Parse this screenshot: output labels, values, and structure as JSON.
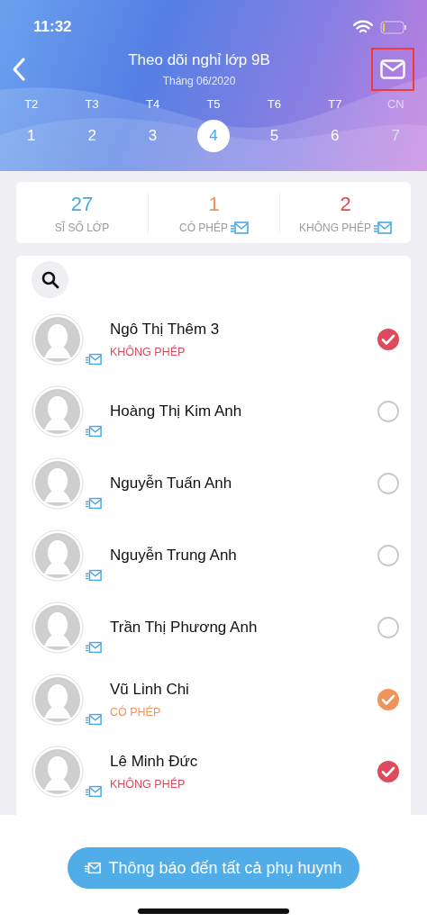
{
  "status_bar": {
    "time": "11:32"
  },
  "header": {
    "title": "Theo dõi nghỉ lớp 9B",
    "subtitle": "Tháng 06/2020",
    "mail_highlighted": true
  },
  "days": [
    {
      "label": "T2",
      "date": "1",
      "selected": false,
      "disabled": false
    },
    {
      "label": "T3",
      "date": "2",
      "selected": false,
      "disabled": false
    },
    {
      "label": "T4",
      "date": "3",
      "selected": false,
      "disabled": false
    },
    {
      "label": "T5",
      "date": "4",
      "selected": true,
      "disabled": false
    },
    {
      "label": "T6",
      "date": "5",
      "selected": false,
      "disabled": false
    },
    {
      "label": "T7",
      "date": "6",
      "selected": false,
      "disabled": false
    },
    {
      "label": "CN",
      "date": "7",
      "selected": false,
      "disabled": true
    }
  ],
  "stats": [
    {
      "value": "27",
      "label": "SĨ SỐ LỚP",
      "kind": "total",
      "mail": false
    },
    {
      "value": "1",
      "label": "CÓ PHÉP",
      "kind": "excused",
      "mail": true
    },
    {
      "value": "2",
      "label": "KHÔNG PHÉP",
      "kind": "unexcused",
      "mail": true
    }
  ],
  "students": [
    {
      "name": "Ngô Thị Thêm 3",
      "status": "KHÔNG PHÉP",
      "kind": "unexcused",
      "checked": true
    },
    {
      "name": "Hoàng Thị Kim Anh",
      "checked": false
    },
    {
      "name": "Nguyễn Tuấn Anh",
      "checked": false
    },
    {
      "name": "Nguyễn Trung Anh",
      "checked": false
    },
    {
      "name": "Trần Thị Phương Anh",
      "checked": false
    },
    {
      "name": "Vũ Linh Chi",
      "status": "CÓ PHÉP",
      "kind": "excused",
      "checked": true
    },
    {
      "name": "Lê Minh Đức",
      "status": "KHÔNG PHÉP",
      "kind": "unexcused",
      "checked": true
    }
  ],
  "notify_button": {
    "label": "Thông báo đến tất cả phụ huynh"
  }
}
